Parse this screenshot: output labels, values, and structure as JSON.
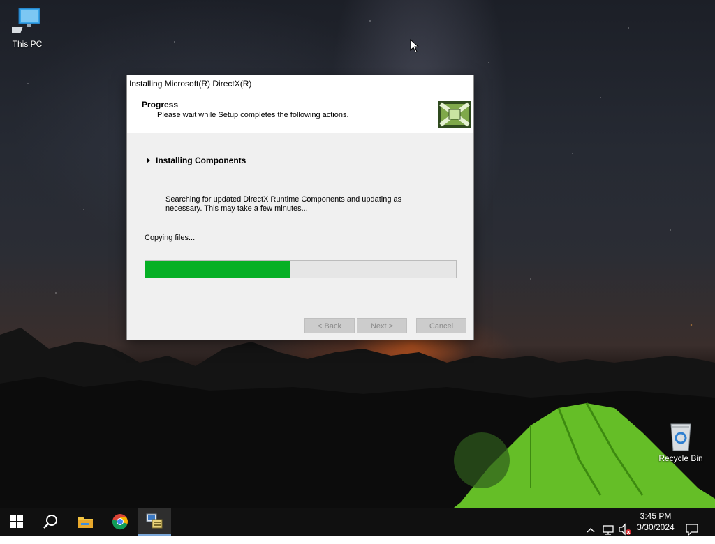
{
  "desktop": {
    "icons": [
      {
        "label": "This PC"
      },
      {
        "label": "Recycle Bin"
      }
    ]
  },
  "dialog": {
    "title": "Installing Microsoft(R) DirectX(R)",
    "header_title": "Progress",
    "header_subtitle": "Please wait while Setup completes the following actions.",
    "step_label": "Installing Components",
    "description": "Searching for updated DirectX Runtime Components and updating as necessary. This may take a few minutes...",
    "status": "Copying files...",
    "progress_fraction": 0.465,
    "buttons": {
      "back": "< Back",
      "next": "Next >",
      "cancel": "Cancel"
    }
  },
  "taskbar": {
    "time": "3:45 PM",
    "date": "3/30/2024",
    "apps": [
      "start-icon",
      "search-icon",
      "file-explorer-icon",
      "chrome-icon",
      "directx-setup-icon"
    ],
    "tray": [
      "chevron-up-icon",
      "network-icon",
      "volume-muted-icon",
      "notification-icon"
    ]
  },
  "colors": {
    "progress_fill": "#06b025",
    "taskbar_bg": "#101010",
    "dialog_bg": "#f0f0f0"
  }
}
